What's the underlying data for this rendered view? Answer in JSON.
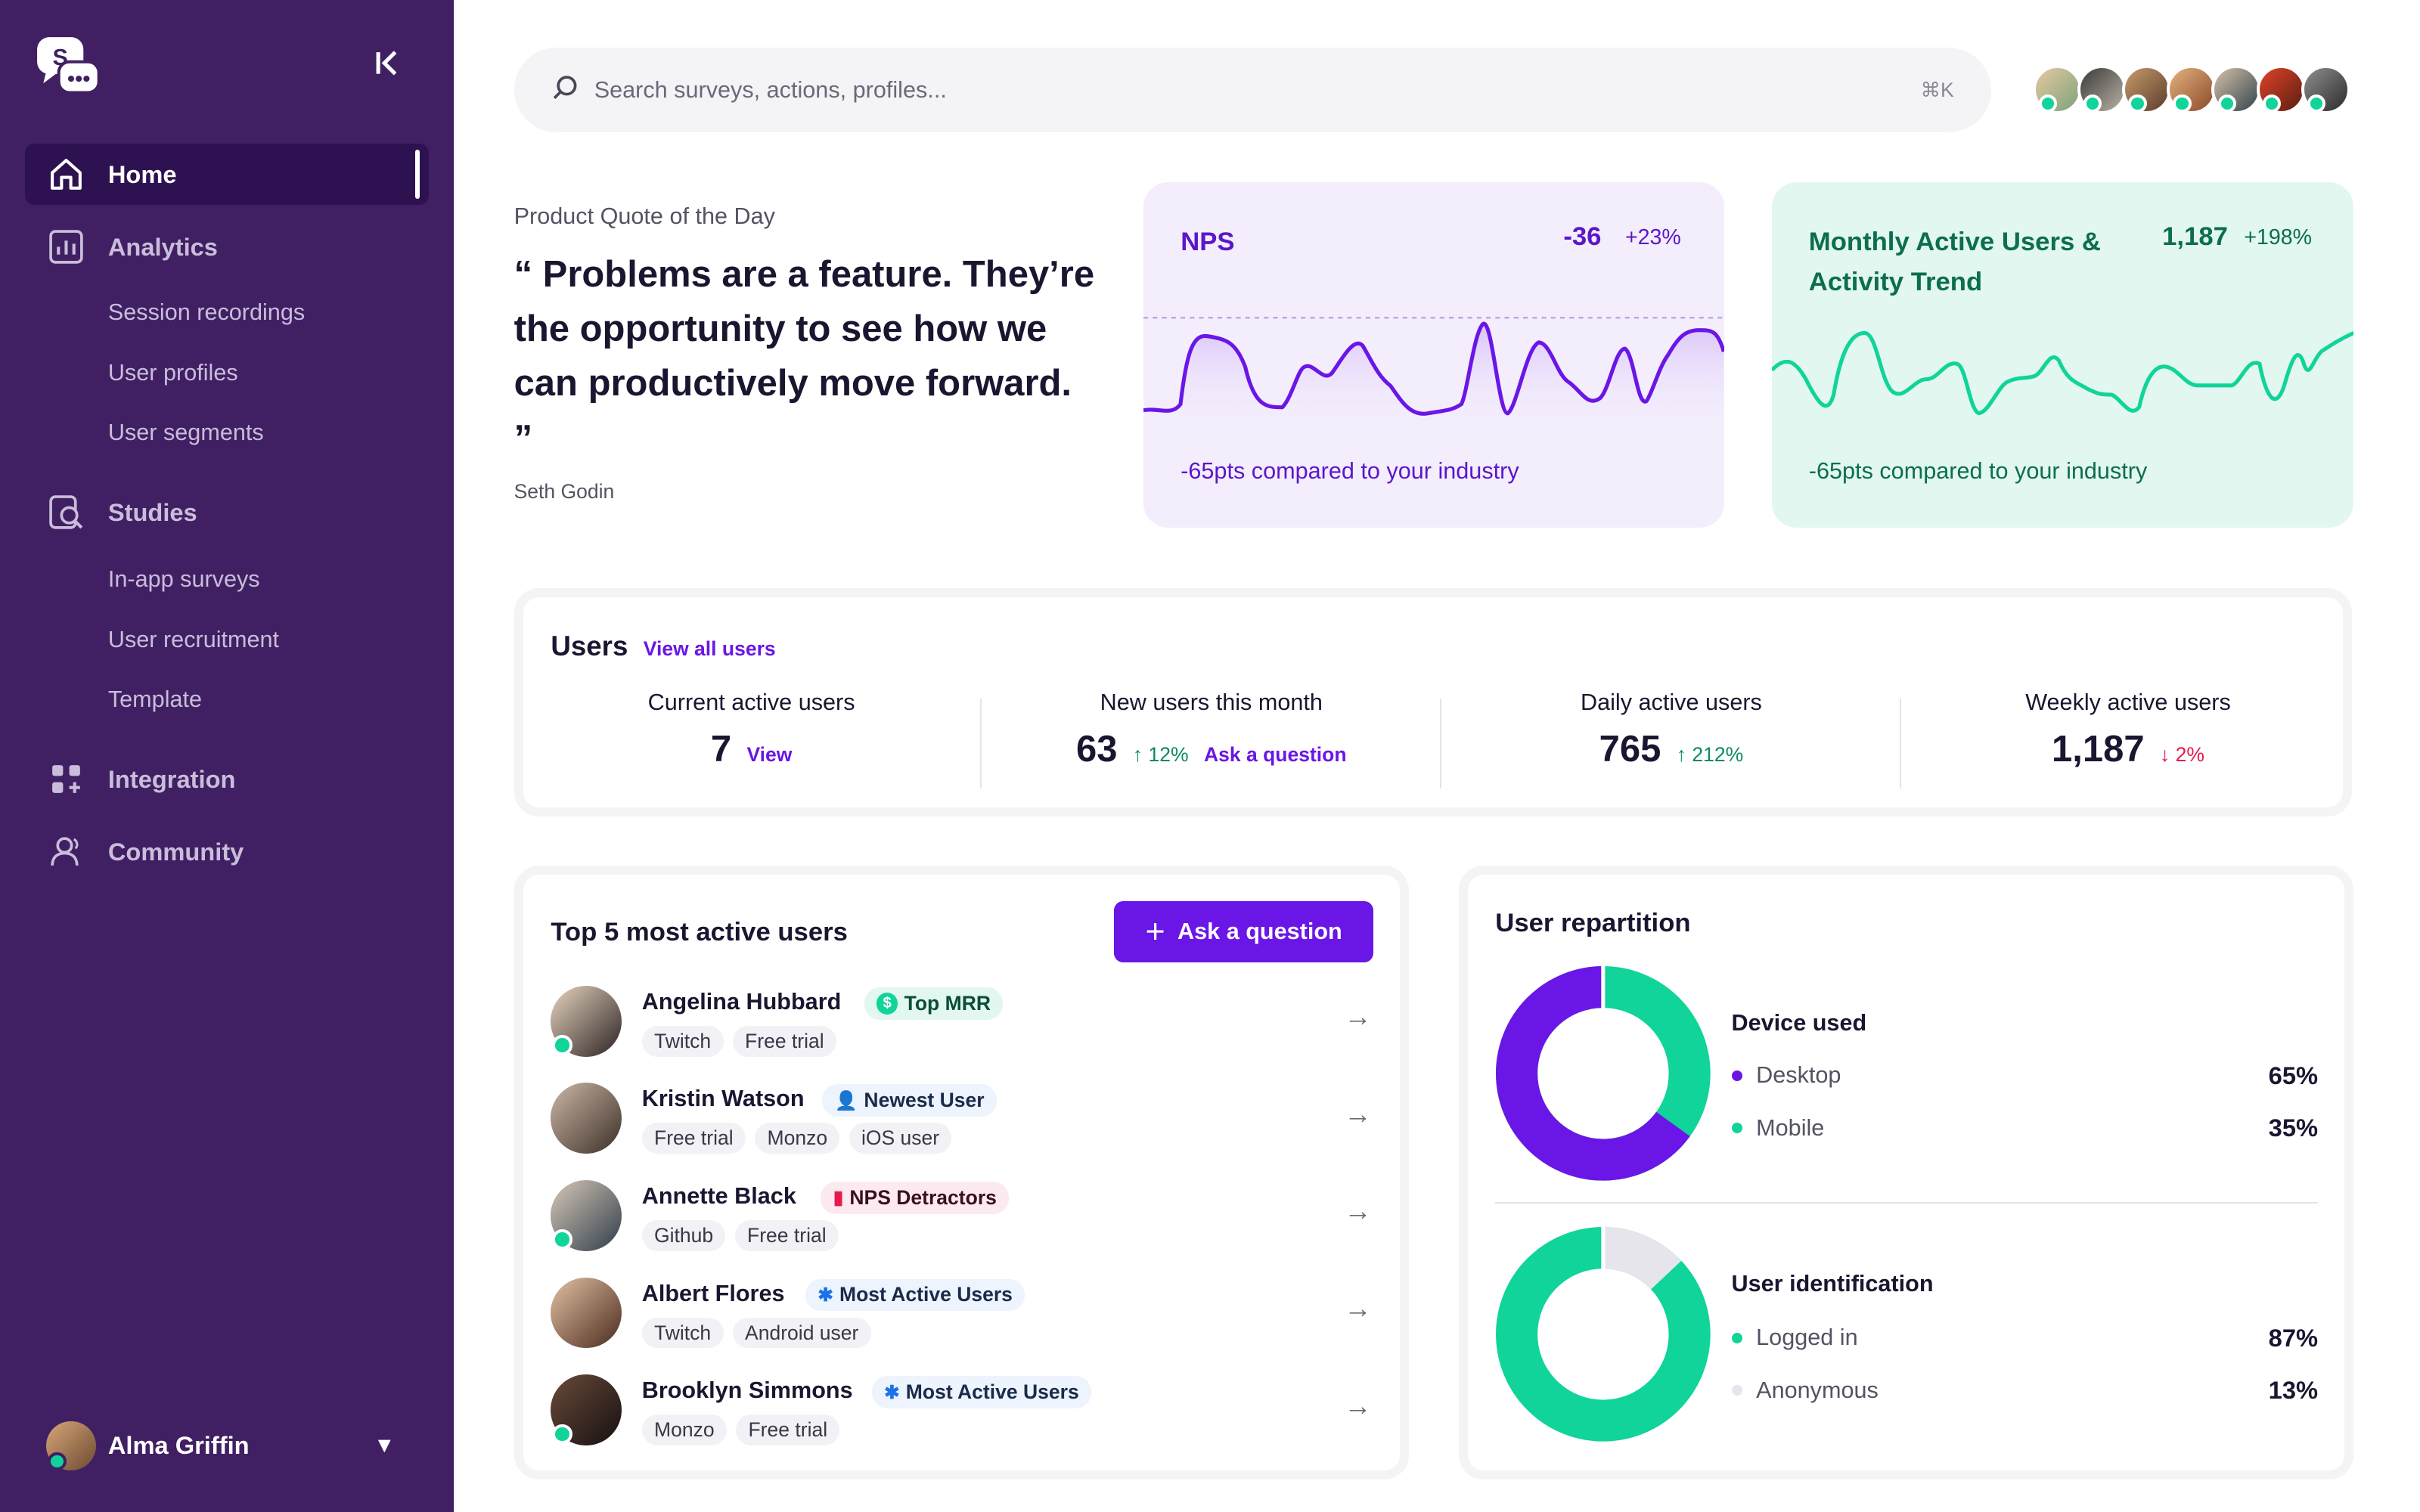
{
  "sidebar": {
    "collapse_icon": "collapse-left-icon",
    "items": [
      {
        "label": "Home",
        "icon": "home-icon"
      },
      {
        "label": "Analytics",
        "icon": "analytics-icon"
      },
      {
        "label": "Studies",
        "icon": "studies-icon"
      },
      {
        "label": "Integration",
        "icon": "integration-icon"
      },
      {
        "label": "Community",
        "icon": "community-icon"
      }
    ],
    "analytics_sub": [
      "Session recordings",
      "User profiles",
      "User segments"
    ],
    "studies_sub": [
      "In-app surveys",
      "User recruitment",
      "Template"
    ],
    "profile_name": "Alma Griffin"
  },
  "search": {
    "placeholder": "Search surveys, actions, profiles...",
    "shortcut": "⌘K"
  },
  "quote": {
    "label": "Product Quote of the Day",
    "text": "“ Problems are a feature. They’re the opportunity to see how we can productively move forward. ”",
    "author": "Seth Godin"
  },
  "nps": {
    "title": "NPS",
    "value": "-36",
    "change": "+23%",
    "footer": "-65pts compared to your industry",
    "color": "#6a16e6"
  },
  "mau": {
    "title": "Monthly Active Users & Activity Trend",
    "value": "1,187",
    "change": "+198%",
    "footer": "-65pts compared to your industry",
    "color": "#10d49a"
  },
  "users": {
    "title": "Users",
    "link": "View all users",
    "stats": [
      {
        "label": "Current active users",
        "value": "7",
        "extra": "View"
      },
      {
        "label": "New users this month",
        "value": "63",
        "change": "↑ 12%",
        "extra": "Ask a question"
      },
      {
        "label": "Daily active users",
        "value": "765",
        "change": "↑ 212%"
      },
      {
        "label": "Weekly active users",
        "value": "1,187",
        "change": "↓ 2%"
      }
    ]
  },
  "top5": {
    "title": "Top 5 most active users",
    "button": "Ask a question",
    "rows": [
      {
        "name": "Angelina Hubbard",
        "badge": "Top MRR",
        "tags": [
          "Twitch",
          "Free trial"
        ]
      },
      {
        "name": "Kristin Watson",
        "badge": "Newest User",
        "tags": [
          "Free trial",
          "Monzo",
          "iOS user"
        ]
      },
      {
        "name": "Annette Black",
        "badge": "NPS Detractors",
        "tags": [
          "Github",
          "Free trial"
        ]
      },
      {
        "name": "Albert Flores",
        "badge": "Most Active Users",
        "tags": [
          "Twitch",
          "Android user"
        ]
      },
      {
        "name": "Brooklyn Simmons",
        "badge": "Most Active Users",
        "tags": [
          "Monzo",
          "Free trial"
        ]
      }
    ]
  },
  "repartition": {
    "title": "User repartition",
    "device": {
      "title": "Device used",
      "items": [
        {
          "label": "Desktop",
          "value": "65%"
        },
        {
          "label": "Mobile",
          "value": "35%"
        }
      ]
    },
    "identification": {
      "title": "User identification",
      "items": [
        {
          "label": "Logged in",
          "value": "87%"
        },
        {
          "label": "Anonymous",
          "value": "13%"
        }
      ]
    }
  }
}
